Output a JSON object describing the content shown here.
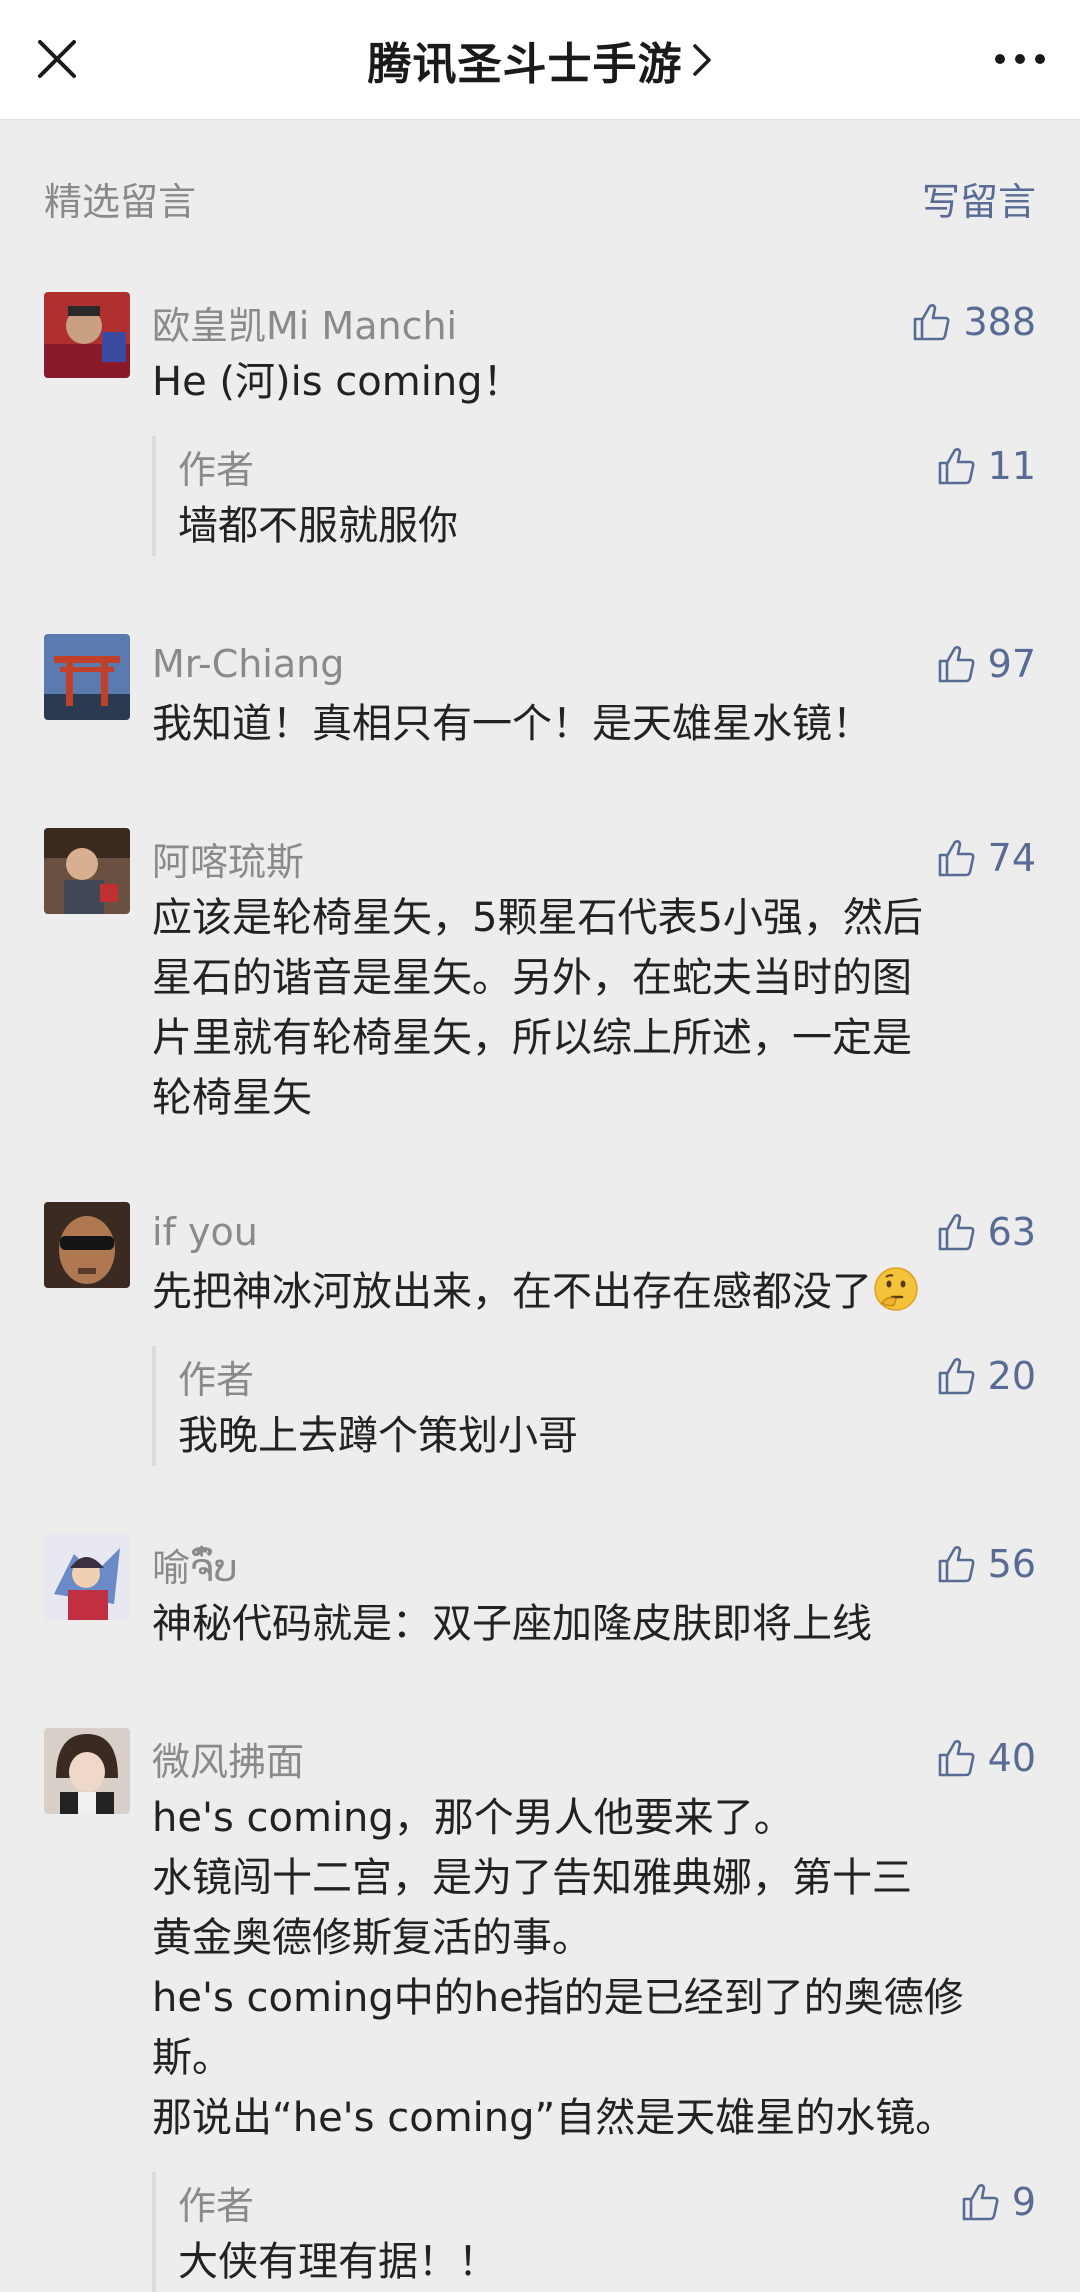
{
  "header": {
    "title": "腾讯圣斗士手游",
    "close_icon": "close-icon",
    "more_icon": "more-dots-icon",
    "chevron_icon": "chevron-right-icon"
  },
  "section": {
    "title": "精选留言",
    "write": "写留言"
  },
  "colors": {
    "accent": "#576b95",
    "muted": "#8a8a8a",
    "background": "#ededed"
  },
  "comments": [
    {
      "nick": "欧皇凯Mi Manchi",
      "likes": "388",
      "text": "He (河)is coming！",
      "reply": {
        "nick": "作者",
        "likes": "11",
        "text": "墙都不服就服你"
      }
    },
    {
      "nick": "Mr-Chiang",
      "likes": "97",
      "text": "我知道！真相只有一个！是天雄星水镜！"
    },
    {
      "nick": "阿喀琉斯",
      "likes": "74",
      "text": "应该是轮椅星矢，5颗星石代表5小强，然后\n星石的谐音是星矢。另外，在蛇夫当时的图\n片里就有轮椅星矢，所以综上所述，一定是\n轮椅星矢"
    },
    {
      "nick": "if you",
      "likes": "63",
      "text": "先把神冰河放出来，在不出存在感都没了",
      "emoji": "thinking-face-emoji",
      "reply": {
        "nick": "作者",
        "likes": "20",
        "text": "我晚上去蹲个策划小哥"
      }
    },
    {
      "nick": "喻ຈົ໋ບ",
      "likes": "56",
      "text": "神秘代码就是：双子座加隆皮肤即将上线"
    },
    {
      "nick": "微风拂面",
      "likes": "40",
      "text": "he's coming，那个男人他要来了。\n水镜闯十二宫，是为了告知雅典娜，第十三\n黄金奥德修斯复活的事。\nhe's coming中的he指的是已经到了的奥德修\n斯。\n那说出“he's coming”自然是天雄星的水镜。",
      "reply": {
        "nick": "作者",
        "likes": "9",
        "text": "大侠有理有据！！"
      }
    }
  ]
}
